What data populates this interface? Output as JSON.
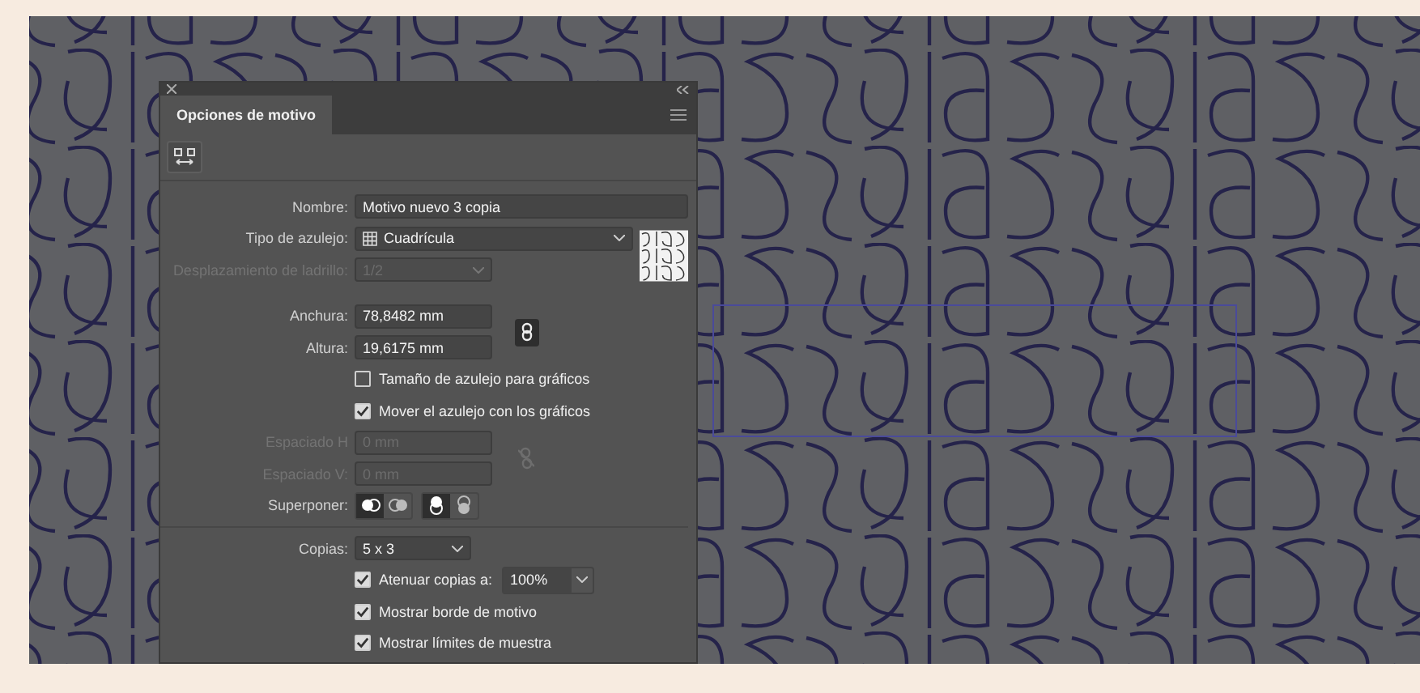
{
  "tab": {
    "label": "Opciones de motivo",
    "selected": true
  },
  "name_field": {
    "label": "Nombre:",
    "value": "Motivo nuevo 3 copia"
  },
  "tile_type": {
    "label": "Tipo de azulejo:",
    "value": "Cuadrícula"
  },
  "brick_offset": {
    "label": "Desplazamiento de ladrillo:",
    "value": "1/2",
    "disabled": true
  },
  "size": [
    {
      "label": "Anchura:",
      "value": "78,8482 mm"
    },
    {
      "label": "Altura:",
      "value": "19,6175 mm"
    }
  ],
  "size_link": {
    "selected": true
  },
  "tile_options": [
    {
      "label": "Tamaño de azulejo para gráficos",
      "checked": false
    },
    {
      "label": "Mover el azulejo con los gráficos",
      "checked": true
    }
  ],
  "spacing": [
    {
      "label": "Espaciado H",
      "value": "0 mm",
      "disabled": true
    },
    {
      "label": "Espaciado V:",
      "value": "0 mm",
      "disabled": true
    }
  ],
  "overlap": {
    "label": "Superponer:",
    "groups": [
      {
        "options": [
          {
            "selected": true
          },
          {
            "selected": false
          }
        ]
      },
      {
        "options": [
          {
            "selected": true
          },
          {
            "selected": false
          }
        ]
      }
    ]
  },
  "copies": {
    "label": "Copias:",
    "value": "5 x 3"
  },
  "dim_copies": {
    "label": "Atenuar copias a:",
    "checked": true,
    "value": "100%"
  },
  "display_options": [
    {
      "label": "Mostrar borde de motivo",
      "checked": true
    },
    {
      "label": "Mostrar límites de muestra",
      "checked": true
    }
  ]
}
